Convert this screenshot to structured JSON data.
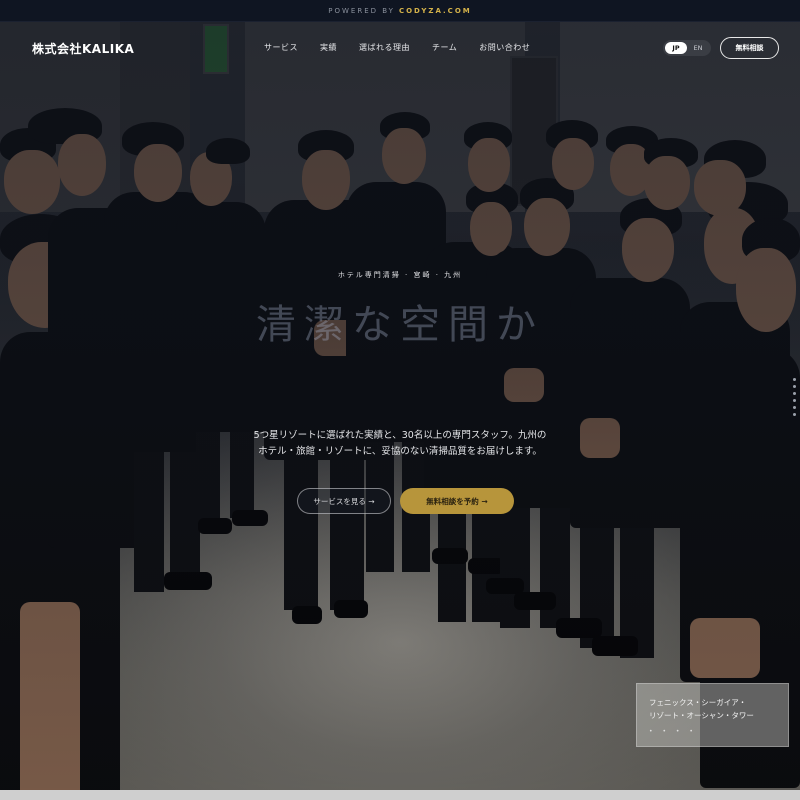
{
  "topbar": {
    "powered_by": "POWERED BY",
    "brand": "CODYZA.COM"
  },
  "nav": {
    "logo": "株式会社KALIKA",
    "menu": [
      "サービス",
      "実績",
      "選ばれる理由",
      "チーム",
      "お問い合わせ"
    ],
    "lang": {
      "jp": "JP",
      "en": "EN",
      "selected": "JP"
    },
    "cta": "無料相談"
  },
  "hero": {
    "eyebrow": "ホテル専門清掃 · 宮崎 · 九州",
    "headline": "清潔な空間か",
    "description_line1": "5つ星リゾートに選ばれた実績と、30名以上の専門スタッフ。九州の",
    "description_line2": "ホテル・旅館・リゾートに、妥協のない清掃品質をお届けします。",
    "btn_services": "サービスを見る →",
    "btn_booking": "無料相談を予約 →"
  },
  "card": {
    "line1": "フェニックス・シーガイア・",
    "line2": "リゾート・オーシャン・タワー",
    "dots": "• • • •"
  },
  "colors": {
    "accent_gold": "#b7953b",
    "brand_link": "#d4b24a",
    "topbar": "#0f1522"
  },
  "icons": {
    "pager": "vertical-dot-pager",
    "exit_sign": "emergency-exit-sign"
  }
}
